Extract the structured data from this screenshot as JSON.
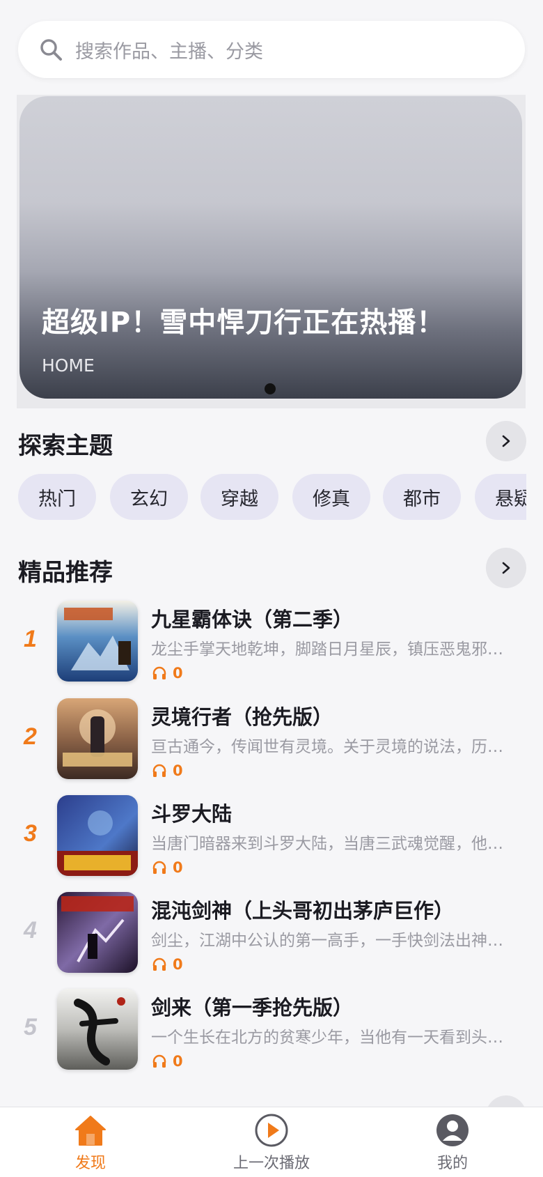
{
  "search": {
    "placeholder": "搜索作品、主播、分类"
  },
  "banner": {
    "title": "超级IP！雪中悍刀行正在热播！",
    "subtitle": "HOME",
    "page_count": 1,
    "active_page": 1
  },
  "topics": {
    "title": "探索主题",
    "chips": [
      "热门",
      "玄幻",
      "穿越",
      "修真",
      "都市",
      "悬疑"
    ]
  },
  "featured": {
    "title": "精品推荐",
    "items": [
      {
        "rank": "1",
        "rank_color": "#f07a1a",
        "title": "九星霸体诀（第二季）",
        "desc": "龙尘手掌天地乾坤，脚踏日月星辰，镇压恶鬼邪神，横推万古",
        "plays": "0",
        "cover_icon": "book-cover-jiuxing"
      },
      {
        "rank": "2",
        "rank_color": "#f07a1a",
        "title": "灵境行者（抢先版）",
        "desc": "亘古通今，传闻世有灵境。关于灵境的说法，历朝历代众说纷纭",
        "plays": "0",
        "cover_icon": "book-cover-lingjing"
      },
      {
        "rank": "3",
        "rank_color": "#f07a1a",
        "title": "斗罗大陆",
        "desc": "当唐门暗器来到斗罗大陆，当唐三武魂觉醒，他能否在这片大陆上",
        "plays": "0",
        "cover_icon": "book-cover-douluo"
      },
      {
        "rank": "4",
        "rank_color": "#c4c4cc",
        "title": "混沌剑神（上头哥初出茅庐巨作）",
        "desc": "剑尘，江湖中公认的第一高手，一手快剑法出神入化，纵横江湖",
        "plays": "0",
        "cover_icon": "book-cover-hundun"
      },
      {
        "rank": "5",
        "rank_color": "#c4c4cc",
        "title": "剑来（第一季抢先版）",
        "desc": "一个生长在北方的贫寒少年，当他有一天看到头顶的那片天空",
        "plays": "0",
        "cover_icon": "book-cover-jianlai"
      }
    ]
  },
  "tabbar": {
    "tabs": [
      {
        "label": "发现",
        "icon": "home-icon",
        "active": true
      },
      {
        "label": "上一次播放",
        "icon": "play-circle-icon",
        "active": false
      },
      {
        "label": "我的",
        "icon": "profile-icon",
        "active": false
      }
    ]
  },
  "colors": {
    "accent": "#f07a1a",
    "chip_bg": "#e6e5f3",
    "muted_rank": "#c4c4cc"
  }
}
